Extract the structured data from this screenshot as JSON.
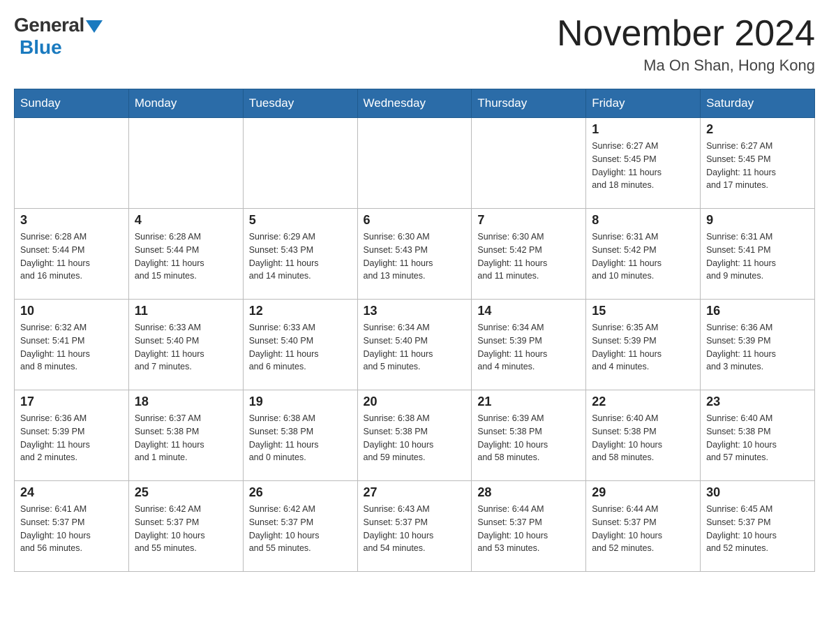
{
  "logo": {
    "general": "General",
    "blue": "Blue"
  },
  "title": "November 2024",
  "location": "Ma On Shan, Hong Kong",
  "weekdays": [
    "Sunday",
    "Monday",
    "Tuesday",
    "Wednesday",
    "Thursday",
    "Friday",
    "Saturday"
  ],
  "weeks": [
    [
      {
        "day": "",
        "info": ""
      },
      {
        "day": "",
        "info": ""
      },
      {
        "day": "",
        "info": ""
      },
      {
        "day": "",
        "info": ""
      },
      {
        "day": "",
        "info": ""
      },
      {
        "day": "1",
        "info": "Sunrise: 6:27 AM\nSunset: 5:45 PM\nDaylight: 11 hours\nand 18 minutes."
      },
      {
        "day": "2",
        "info": "Sunrise: 6:27 AM\nSunset: 5:45 PM\nDaylight: 11 hours\nand 17 minutes."
      }
    ],
    [
      {
        "day": "3",
        "info": "Sunrise: 6:28 AM\nSunset: 5:44 PM\nDaylight: 11 hours\nand 16 minutes."
      },
      {
        "day": "4",
        "info": "Sunrise: 6:28 AM\nSunset: 5:44 PM\nDaylight: 11 hours\nand 15 minutes."
      },
      {
        "day": "5",
        "info": "Sunrise: 6:29 AM\nSunset: 5:43 PM\nDaylight: 11 hours\nand 14 minutes."
      },
      {
        "day": "6",
        "info": "Sunrise: 6:30 AM\nSunset: 5:43 PM\nDaylight: 11 hours\nand 13 minutes."
      },
      {
        "day": "7",
        "info": "Sunrise: 6:30 AM\nSunset: 5:42 PM\nDaylight: 11 hours\nand 11 minutes."
      },
      {
        "day": "8",
        "info": "Sunrise: 6:31 AM\nSunset: 5:42 PM\nDaylight: 11 hours\nand 10 minutes."
      },
      {
        "day": "9",
        "info": "Sunrise: 6:31 AM\nSunset: 5:41 PM\nDaylight: 11 hours\nand 9 minutes."
      }
    ],
    [
      {
        "day": "10",
        "info": "Sunrise: 6:32 AM\nSunset: 5:41 PM\nDaylight: 11 hours\nand 8 minutes."
      },
      {
        "day": "11",
        "info": "Sunrise: 6:33 AM\nSunset: 5:40 PM\nDaylight: 11 hours\nand 7 minutes."
      },
      {
        "day": "12",
        "info": "Sunrise: 6:33 AM\nSunset: 5:40 PM\nDaylight: 11 hours\nand 6 minutes."
      },
      {
        "day": "13",
        "info": "Sunrise: 6:34 AM\nSunset: 5:40 PM\nDaylight: 11 hours\nand 5 minutes."
      },
      {
        "day": "14",
        "info": "Sunrise: 6:34 AM\nSunset: 5:39 PM\nDaylight: 11 hours\nand 4 minutes."
      },
      {
        "day": "15",
        "info": "Sunrise: 6:35 AM\nSunset: 5:39 PM\nDaylight: 11 hours\nand 4 minutes."
      },
      {
        "day": "16",
        "info": "Sunrise: 6:36 AM\nSunset: 5:39 PM\nDaylight: 11 hours\nand 3 minutes."
      }
    ],
    [
      {
        "day": "17",
        "info": "Sunrise: 6:36 AM\nSunset: 5:39 PM\nDaylight: 11 hours\nand 2 minutes."
      },
      {
        "day": "18",
        "info": "Sunrise: 6:37 AM\nSunset: 5:38 PM\nDaylight: 11 hours\nand 1 minute."
      },
      {
        "day": "19",
        "info": "Sunrise: 6:38 AM\nSunset: 5:38 PM\nDaylight: 11 hours\nand 0 minutes."
      },
      {
        "day": "20",
        "info": "Sunrise: 6:38 AM\nSunset: 5:38 PM\nDaylight: 10 hours\nand 59 minutes."
      },
      {
        "day": "21",
        "info": "Sunrise: 6:39 AM\nSunset: 5:38 PM\nDaylight: 10 hours\nand 58 minutes."
      },
      {
        "day": "22",
        "info": "Sunrise: 6:40 AM\nSunset: 5:38 PM\nDaylight: 10 hours\nand 58 minutes."
      },
      {
        "day": "23",
        "info": "Sunrise: 6:40 AM\nSunset: 5:38 PM\nDaylight: 10 hours\nand 57 minutes."
      }
    ],
    [
      {
        "day": "24",
        "info": "Sunrise: 6:41 AM\nSunset: 5:37 PM\nDaylight: 10 hours\nand 56 minutes."
      },
      {
        "day": "25",
        "info": "Sunrise: 6:42 AM\nSunset: 5:37 PM\nDaylight: 10 hours\nand 55 minutes."
      },
      {
        "day": "26",
        "info": "Sunrise: 6:42 AM\nSunset: 5:37 PM\nDaylight: 10 hours\nand 55 minutes."
      },
      {
        "day": "27",
        "info": "Sunrise: 6:43 AM\nSunset: 5:37 PM\nDaylight: 10 hours\nand 54 minutes."
      },
      {
        "day": "28",
        "info": "Sunrise: 6:44 AM\nSunset: 5:37 PM\nDaylight: 10 hours\nand 53 minutes."
      },
      {
        "day": "29",
        "info": "Sunrise: 6:44 AM\nSunset: 5:37 PM\nDaylight: 10 hours\nand 52 minutes."
      },
      {
        "day": "30",
        "info": "Sunrise: 6:45 AM\nSunset: 5:37 PM\nDaylight: 10 hours\nand 52 minutes."
      }
    ]
  ]
}
